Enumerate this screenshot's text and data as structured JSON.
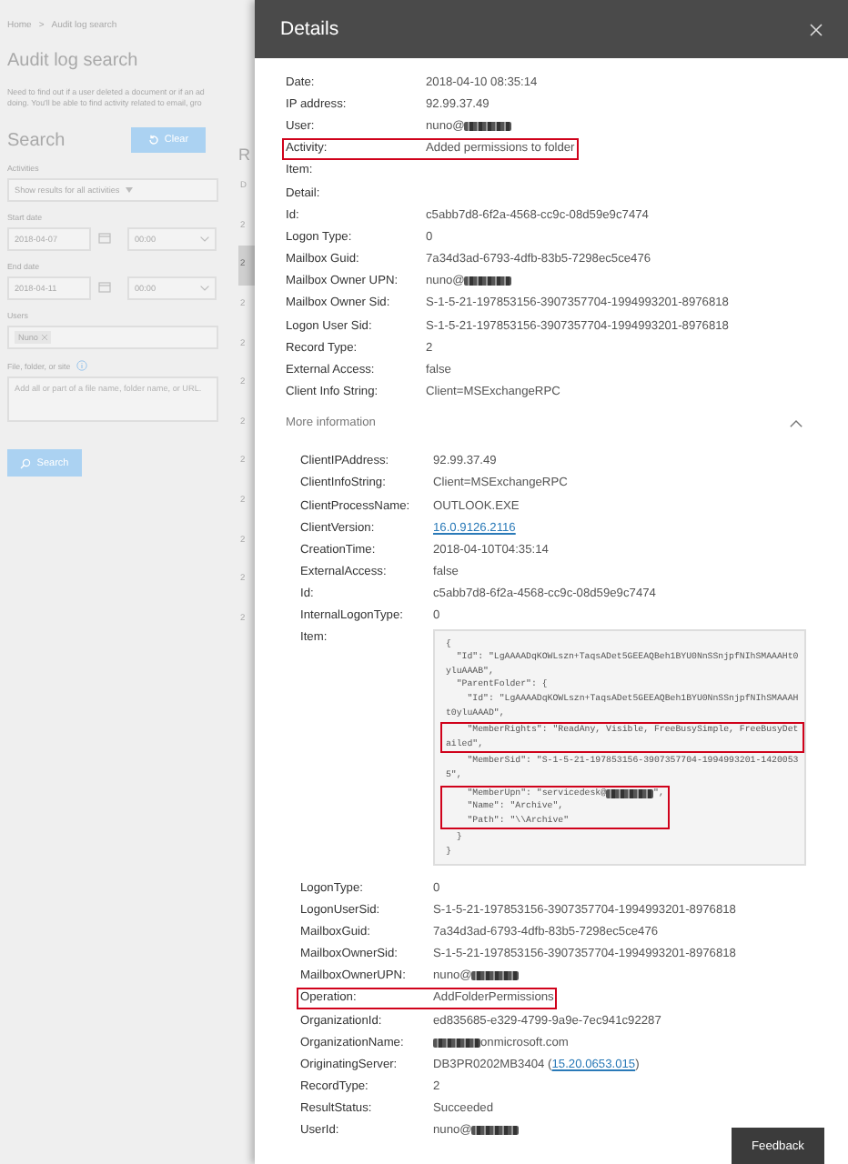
{
  "page": {
    "breadcrumb": [
      "Home",
      ">",
      "Audit log search"
    ],
    "title": "Audit log search",
    "description_lines": [
      "Need to find out if a user deleted a document or if an ad",
      "doing. You'll be able to find activity related to email, gro"
    ],
    "search_heading": "Search",
    "clear_button": "Clear",
    "activities": {
      "label": "Activities",
      "value": "Show results for all activities"
    },
    "start_date": {
      "label": "Start date",
      "date": "2018-04-07",
      "time": "00:00"
    },
    "end_date": {
      "label": "End date",
      "date": "2018-04-11",
      "time": "00:00"
    },
    "users": {
      "label": "Users",
      "tags": [
        "Nuno"
      ]
    },
    "file": {
      "label": "File, folder, or site",
      "placeholder": "Add all or part of a file name, folder name, or URL."
    },
    "search_button": "Search",
    "results": {
      "heading": "R",
      "column_1": "D",
      "rows": [
        {
          "text": "2",
          "selected": false
        },
        {
          "text": "2",
          "selected": true
        },
        {
          "text": "2",
          "selected": false
        },
        {
          "text": "2",
          "selected": false
        },
        {
          "text": "2",
          "selected": false
        },
        {
          "text": "2",
          "selected": false
        },
        {
          "text": "2",
          "selected": false
        },
        {
          "text": "2",
          "selected": false
        },
        {
          "text": "2",
          "selected": false
        },
        {
          "text": "2",
          "selected": false
        },
        {
          "text": "2",
          "selected": false
        }
      ]
    }
  },
  "details": {
    "title": "Details",
    "rows": [
      {
        "label": "Date:",
        "value": "2018-04-10 08:35:14",
        "highlighted": false
      },
      {
        "label": "IP address:",
        "value": "92.99.37.49",
        "highlighted": false
      },
      {
        "label": "User:",
        "value": "nuno@",
        "redacted_after": true,
        "highlighted": false
      },
      {
        "label": "Activity:",
        "value": "Added permissions to folder",
        "highlighted": true
      },
      {
        "label": "Item:",
        "highlighted": false
      },
      {
        "label": "Detail:",
        "highlighted": false
      },
      {
        "label": "Id:",
        "value": "c5abb7d8-6f2a-4568-cc9c-08d59e9c7474",
        "highlighted": false
      },
      {
        "label": "Logon Type:",
        "value": "0",
        "highlighted": false
      },
      {
        "label": "Mailbox Guid:",
        "value": "7a34d3ad-6793-4dfb-83b5-7298ec5ce476",
        "highlighted": false
      },
      {
        "label": "Mailbox Owner UPN:",
        "value": "nuno@",
        "redacted_after": true,
        "highlighted": false
      },
      {
        "label": "Mailbox Owner Sid:",
        "value": "S-1-5-21-197853156-3907357704-1994993201-8976818",
        "highlighted": false
      },
      {
        "label": "Logon User Sid:",
        "value": "S-1-5-21-197853156-3907357704-1994993201-8976818",
        "highlighted": false
      },
      {
        "label": "Record Type:",
        "value": "2",
        "highlighted": false
      },
      {
        "label": "External Access:",
        "value": "false",
        "highlighted": false
      },
      {
        "label": "Client Info String:",
        "value": "Client=MSExchangeRPC",
        "highlighted": false
      }
    ],
    "more_information": {
      "label": "More information",
      "expanded": true,
      "rows": [
        {
          "kind": "text",
          "label": "ClientIPAddress:",
          "value": "92.99.37.49",
          "highlighted": false
        },
        {
          "kind": "text",
          "label": "ClientInfoString:",
          "value": "Client=MSExchangeRPC",
          "highlighted": false
        },
        {
          "kind": "text",
          "label": "ClientProcessName:",
          "value": "OUTLOOK.EXE",
          "highlighted": false
        },
        {
          "kind": "text",
          "label": "ClientVersion:",
          "link": "16.0.9126.2116",
          "highlighted": false
        },
        {
          "kind": "text",
          "label": "CreationTime:",
          "value": "2018-04-10T04:35:14",
          "highlighted": false
        },
        {
          "kind": "text",
          "label": "ExternalAccess:",
          "value": "false",
          "highlighted": false
        },
        {
          "kind": "text",
          "label": "Id:",
          "value": "c5abb7d8-6f2a-4568-cc9c-08d59e9c7474",
          "highlighted": false
        },
        {
          "kind": "text",
          "label": "InternalLogonType:",
          "value": "0",
          "highlighted": false
        },
        {
          "kind": "json",
          "label": "Item:",
          "blocks": [
            {
              "highlighted": false,
              "lines": [
                {
                  "text": "{"
                },
                {
                  "text": "  \"Id\": \"LgAAAADqKOWLszn+TaqsADet5GEEAQBeh1BYU0NnSSnjpfNIhSMAAAHt0"
                },
                {
                  "text": "yluAAAB\","
                },
                {
                  "text": "  \"ParentFolder\": {"
                },
                {
                  "text": "    \"Id\": \"LgAAAADqKOWLszn+TaqsADet5GEEAQBeh1BYU0NnSSnjpfNIhSMAAAH"
                },
                {
                  "text": "t0yluAAAD\","
                }
              ]
            },
            {
              "highlighted": true,
              "lines": [
                {
                  "text": "    \"MemberRights\": \"ReadAny, Visible, FreeBusySimple, FreeBusyDet"
                },
                {
                  "text": "ailed\","
                }
              ]
            },
            {
              "highlighted": false,
              "lines": [
                {
                  "text": "    \"MemberSid\": \"S-1-5-21-197853156-3907357704-1994993201-1420053"
                },
                {
                  "text": "5\","
                }
              ]
            },
            {
              "highlighted": true,
              "lines": [
                {
                  "text": "    \"MemberUpn\": \"servicedesk@",
                  "redacted_after": true,
                  "tail": "\","
                },
                {
                  "text": "    \"Name\": \"Archive\","
                },
                {
                  "text": "    \"Path\": \"\\\\Archive\""
                }
              ]
            },
            {
              "highlighted": false,
              "lines": [
                {
                  "text": "  }"
                },
                {
                  "text": "}"
                }
              ]
            }
          ],
          "highlighted": false
        },
        {
          "kind": "text",
          "label": "LogonType:",
          "value": "0",
          "highlighted": false
        },
        {
          "kind": "text",
          "label": "LogonUserSid:",
          "value": "S-1-5-21-197853156-3907357704-1994993201-8976818",
          "highlighted": false
        },
        {
          "kind": "text",
          "label": "MailboxGuid:",
          "value": "7a34d3ad-6793-4dfb-83b5-7298ec5ce476",
          "highlighted": false
        },
        {
          "kind": "text",
          "label": "MailboxOwnerSid:",
          "value": "S-1-5-21-197853156-3907357704-1994993201-8976818",
          "highlighted": false
        },
        {
          "kind": "text",
          "label": "MailboxOwnerUPN:",
          "value": "nuno@",
          "redacted_after": true,
          "highlighted": false
        },
        {
          "kind": "text",
          "label": "Operation:",
          "value": "AddFolderPermissions",
          "highlighted": true
        },
        {
          "kind": "text",
          "label": "OrganizationId:",
          "value": "ed835685-e329-4799-9a9e-7ec941c92287",
          "highlighted": false
        },
        {
          "kind": "text",
          "label": "OrganizationName:",
          "value": "onmicrosoft.com",
          "redacted_before": true,
          "highlighted": false
        },
        {
          "kind": "text",
          "label": "OriginatingServer:",
          "value": "DB3PR0202MB3404 (",
          "link": "15.20.0653.015",
          "tail": ")",
          "highlighted": false
        },
        {
          "kind": "text",
          "label": "RecordType:",
          "value": "2",
          "highlighted": false
        },
        {
          "kind": "text",
          "label": "ResultStatus:",
          "value": "Succeeded",
          "highlighted": false
        },
        {
          "kind": "text",
          "label": "UserId:",
          "value": "nuno@",
          "redacted_after": true,
          "highlighted": false
        }
      ]
    },
    "feedback_button": "Feedback"
  }
}
